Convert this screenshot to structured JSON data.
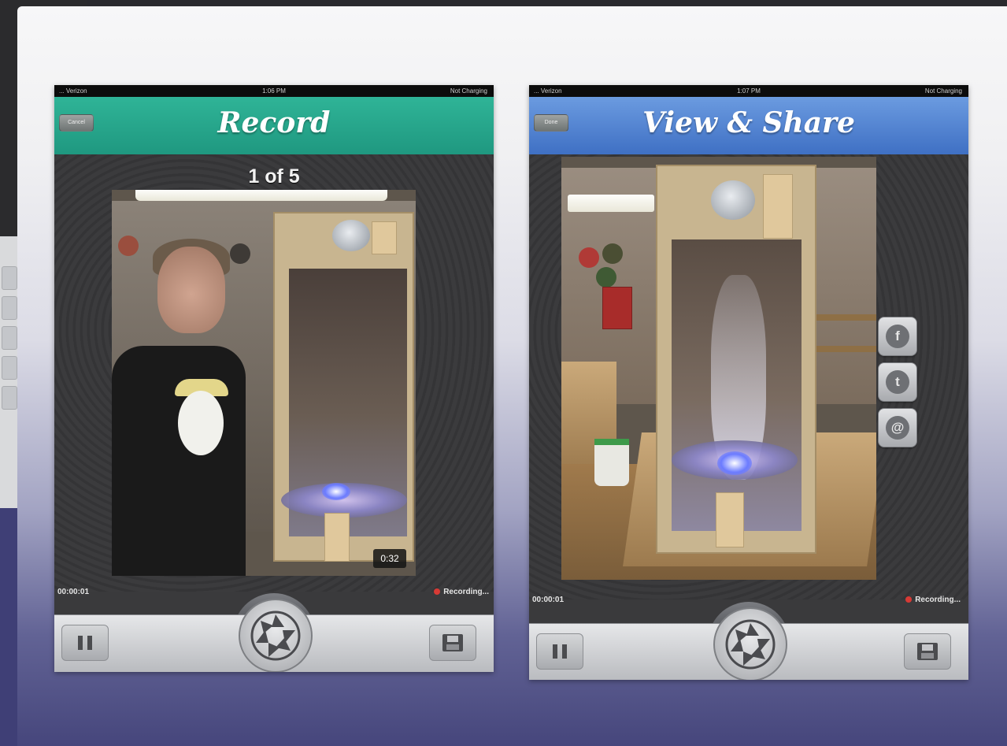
{
  "record_screen": {
    "status": {
      "carrier": "... Verizon",
      "time": "1:06 PM",
      "battery": "Not Charging"
    },
    "nav": {
      "back_label": "Cancel",
      "title": "Record"
    },
    "counter": "1 of 5",
    "video_duration": "0:32",
    "timecode": "00:00:01",
    "recording_status": "Recording..."
  },
  "share_screen": {
    "status": {
      "carrier": "... Verizon",
      "time": "1:07 PM",
      "battery": "Not Charging"
    },
    "nav": {
      "back_label": "Done",
      "title": "View & Share"
    },
    "timecode": "00:00:01",
    "recording_status": "Recording..."
  },
  "share_buttons": [
    {
      "icon": "facebook-icon",
      "glyph": "f"
    },
    {
      "icon": "twitter-icon",
      "glyph": "t"
    },
    {
      "icon": "email-icon",
      "glyph": "@"
    }
  ],
  "colors": {
    "record_nav": "#22a68a",
    "share_nav": "#4f82d3",
    "recording_dot": "#d73a35"
  }
}
